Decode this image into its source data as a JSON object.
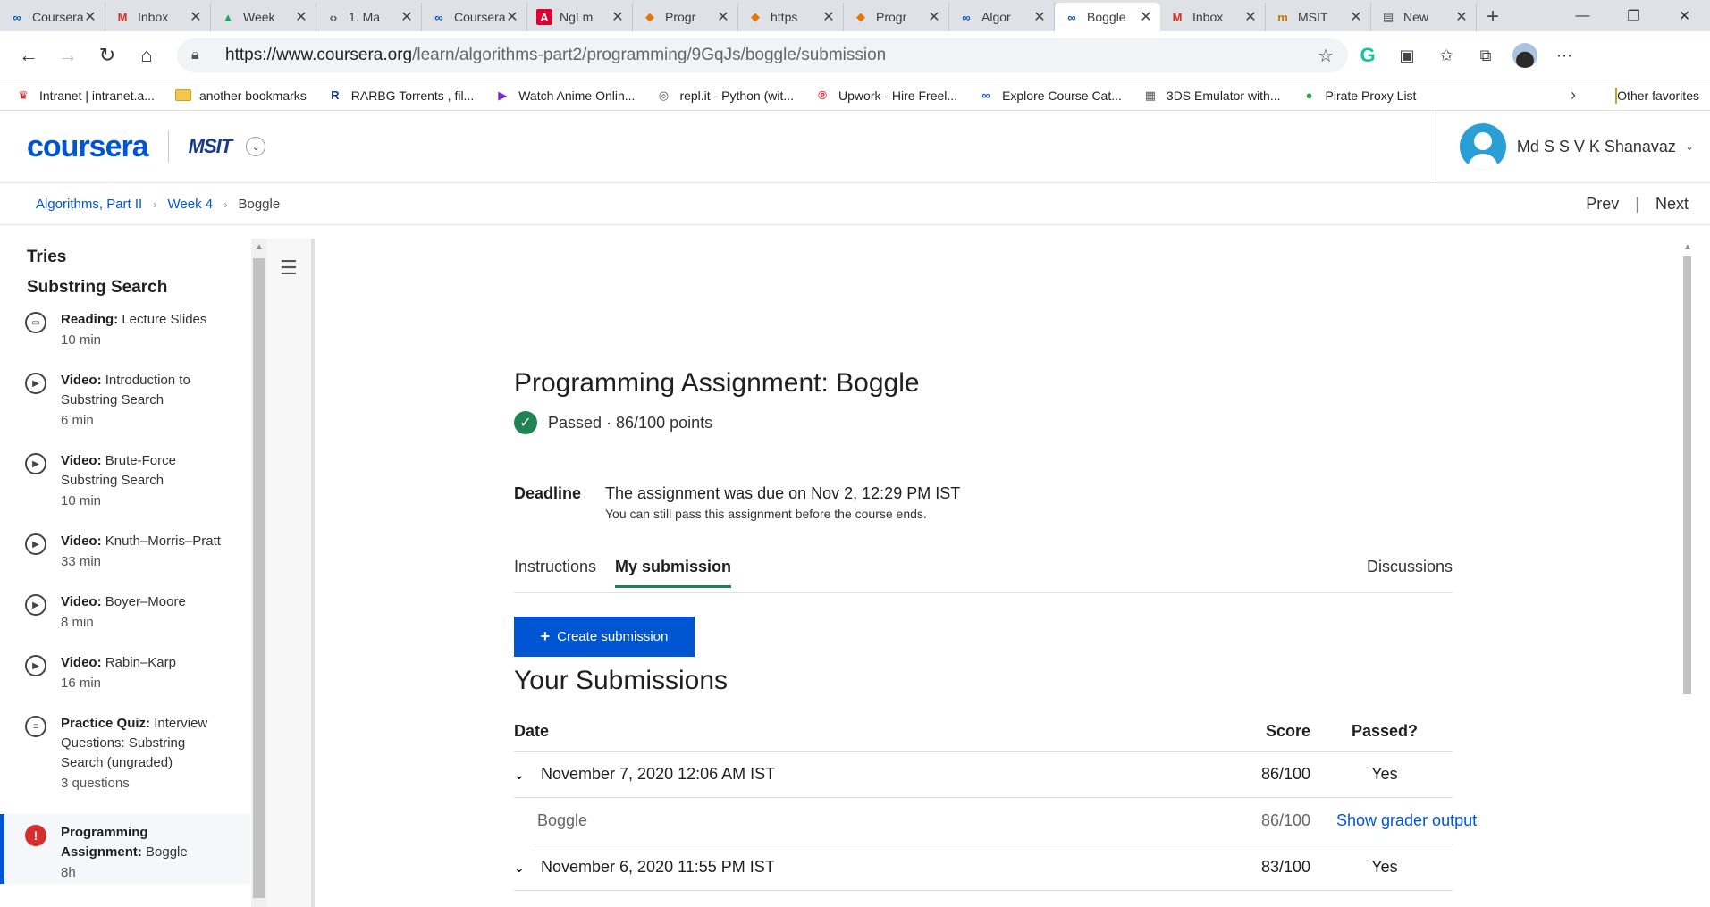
{
  "browser": {
    "tabs": [
      {
        "icon": "coursera-icon",
        "label": "Coursera"
      },
      {
        "icon": "gmail-icon",
        "label": "Inbox"
      },
      {
        "icon": "drive-icon",
        "label": "Week"
      },
      {
        "icon": "code-icon",
        "label": "1. Ma"
      },
      {
        "icon": "coursera-icon",
        "label": "Coursera"
      },
      {
        "icon": "angular-icon",
        "label": "NgLm"
      },
      {
        "icon": "princeton-icon",
        "label": "Progr"
      },
      {
        "icon": "princeton-icon",
        "label": "https"
      },
      {
        "icon": "princeton-icon",
        "label": "Progr"
      },
      {
        "icon": "coursera-icon",
        "label": "Algor"
      },
      {
        "icon": "coursera-icon",
        "label": "Boggle",
        "active": true
      },
      {
        "icon": "gmail-icon",
        "label": "Inbox"
      },
      {
        "icon": "msit-icon",
        "label": "MSIT"
      },
      {
        "icon": "newtab-icon",
        "label": "New"
      }
    ],
    "url_main": "https://www.coursera.org",
    "url_path": "/learn/algorithms-part2/programming/9GqJs/boggle/submission",
    "bookmarks": [
      {
        "icon": "intranet-icon",
        "label": "Intranet | intranet.a..."
      },
      {
        "icon": "folder-icon",
        "label": "another bookmarks"
      },
      {
        "icon": "rarbg-icon",
        "label": "RARBG Torrents , fil..."
      },
      {
        "icon": "play-icon",
        "label": "Watch Anime Onlin..."
      },
      {
        "icon": "replit-icon",
        "label": "repl.it - Python (wit..."
      },
      {
        "icon": "pinterest-icon",
        "label": "Upwork - Hire Freel..."
      },
      {
        "icon": "coursera-icon",
        "label": "Explore Course Cat..."
      },
      {
        "icon": "emulator-icon",
        "label": "3DS Emulator with..."
      },
      {
        "icon": "pirate-icon",
        "label": "Pirate Proxy List"
      }
    ],
    "other_favorites": "Other favorites"
  },
  "header": {
    "logo": "coursera",
    "org": "MSIT",
    "user_name": "Md S S V K Shanavaz"
  },
  "breadcrumb": {
    "course": "Algorithms, Part II",
    "week": "Week 4",
    "current": "Boggle",
    "prev": "Prev",
    "next": "Next"
  },
  "sidebar": {
    "section_prev": "Tries",
    "section": "Substring Search",
    "items": [
      {
        "type": "Reading:",
        "title": "Lecture Slides",
        "duration": "10 min",
        "icon": "book-icon"
      },
      {
        "type": "Video:",
        "title": "Introduction to Substring Search",
        "duration": "6 min",
        "icon": "play-icon"
      },
      {
        "type": "Video:",
        "title": "Brute-Force Substring Search",
        "duration": "10 min",
        "icon": "play-icon"
      },
      {
        "type": "Video:",
        "title": "Knuth–Morris–Pratt",
        "duration": "33 min",
        "icon": "play-icon"
      },
      {
        "type": "Video:",
        "title": "Boyer–Moore",
        "duration": "8 min",
        "icon": "play-icon"
      },
      {
        "type": "Video:",
        "title": "Rabin–Karp",
        "duration": "16 min",
        "icon": "play-icon"
      },
      {
        "type": "Practice Quiz:",
        "title": "Interview Questions: Substring Search (ungraded)",
        "duration": "3 questions",
        "icon": "quiz-icon"
      },
      {
        "type": "Programming Assignment:",
        "title": "Boggle",
        "duration": "8h",
        "icon": "alert-icon"
      }
    ]
  },
  "assignment": {
    "title": "Programming Assignment: Boggle",
    "status": "Passed · 86/100 points",
    "deadline_label": "Deadline",
    "deadline_text": "The assignment was due on Nov 2, 12:29 PM IST",
    "deadline_sub": "You can still pass this assignment before the course ends.",
    "tabs": {
      "instructions": "Instructions",
      "my_submission": "My submission",
      "discussions": "Discussions"
    },
    "create_button": "Create submission",
    "submissions_heading": "Your Submissions",
    "columns": {
      "date": "Date",
      "score": "Score",
      "passed": "Passed?"
    },
    "rows": [
      {
        "date": "November 7, 2020 12:06 AM IST",
        "score": "86/100",
        "passed": "Yes"
      },
      {
        "name": "Boggle",
        "score": "86/100",
        "action": "Show grader output"
      },
      {
        "date": "November 6, 2020 11:55 PM IST",
        "score": "83/100",
        "passed": "Yes"
      }
    ]
  }
}
